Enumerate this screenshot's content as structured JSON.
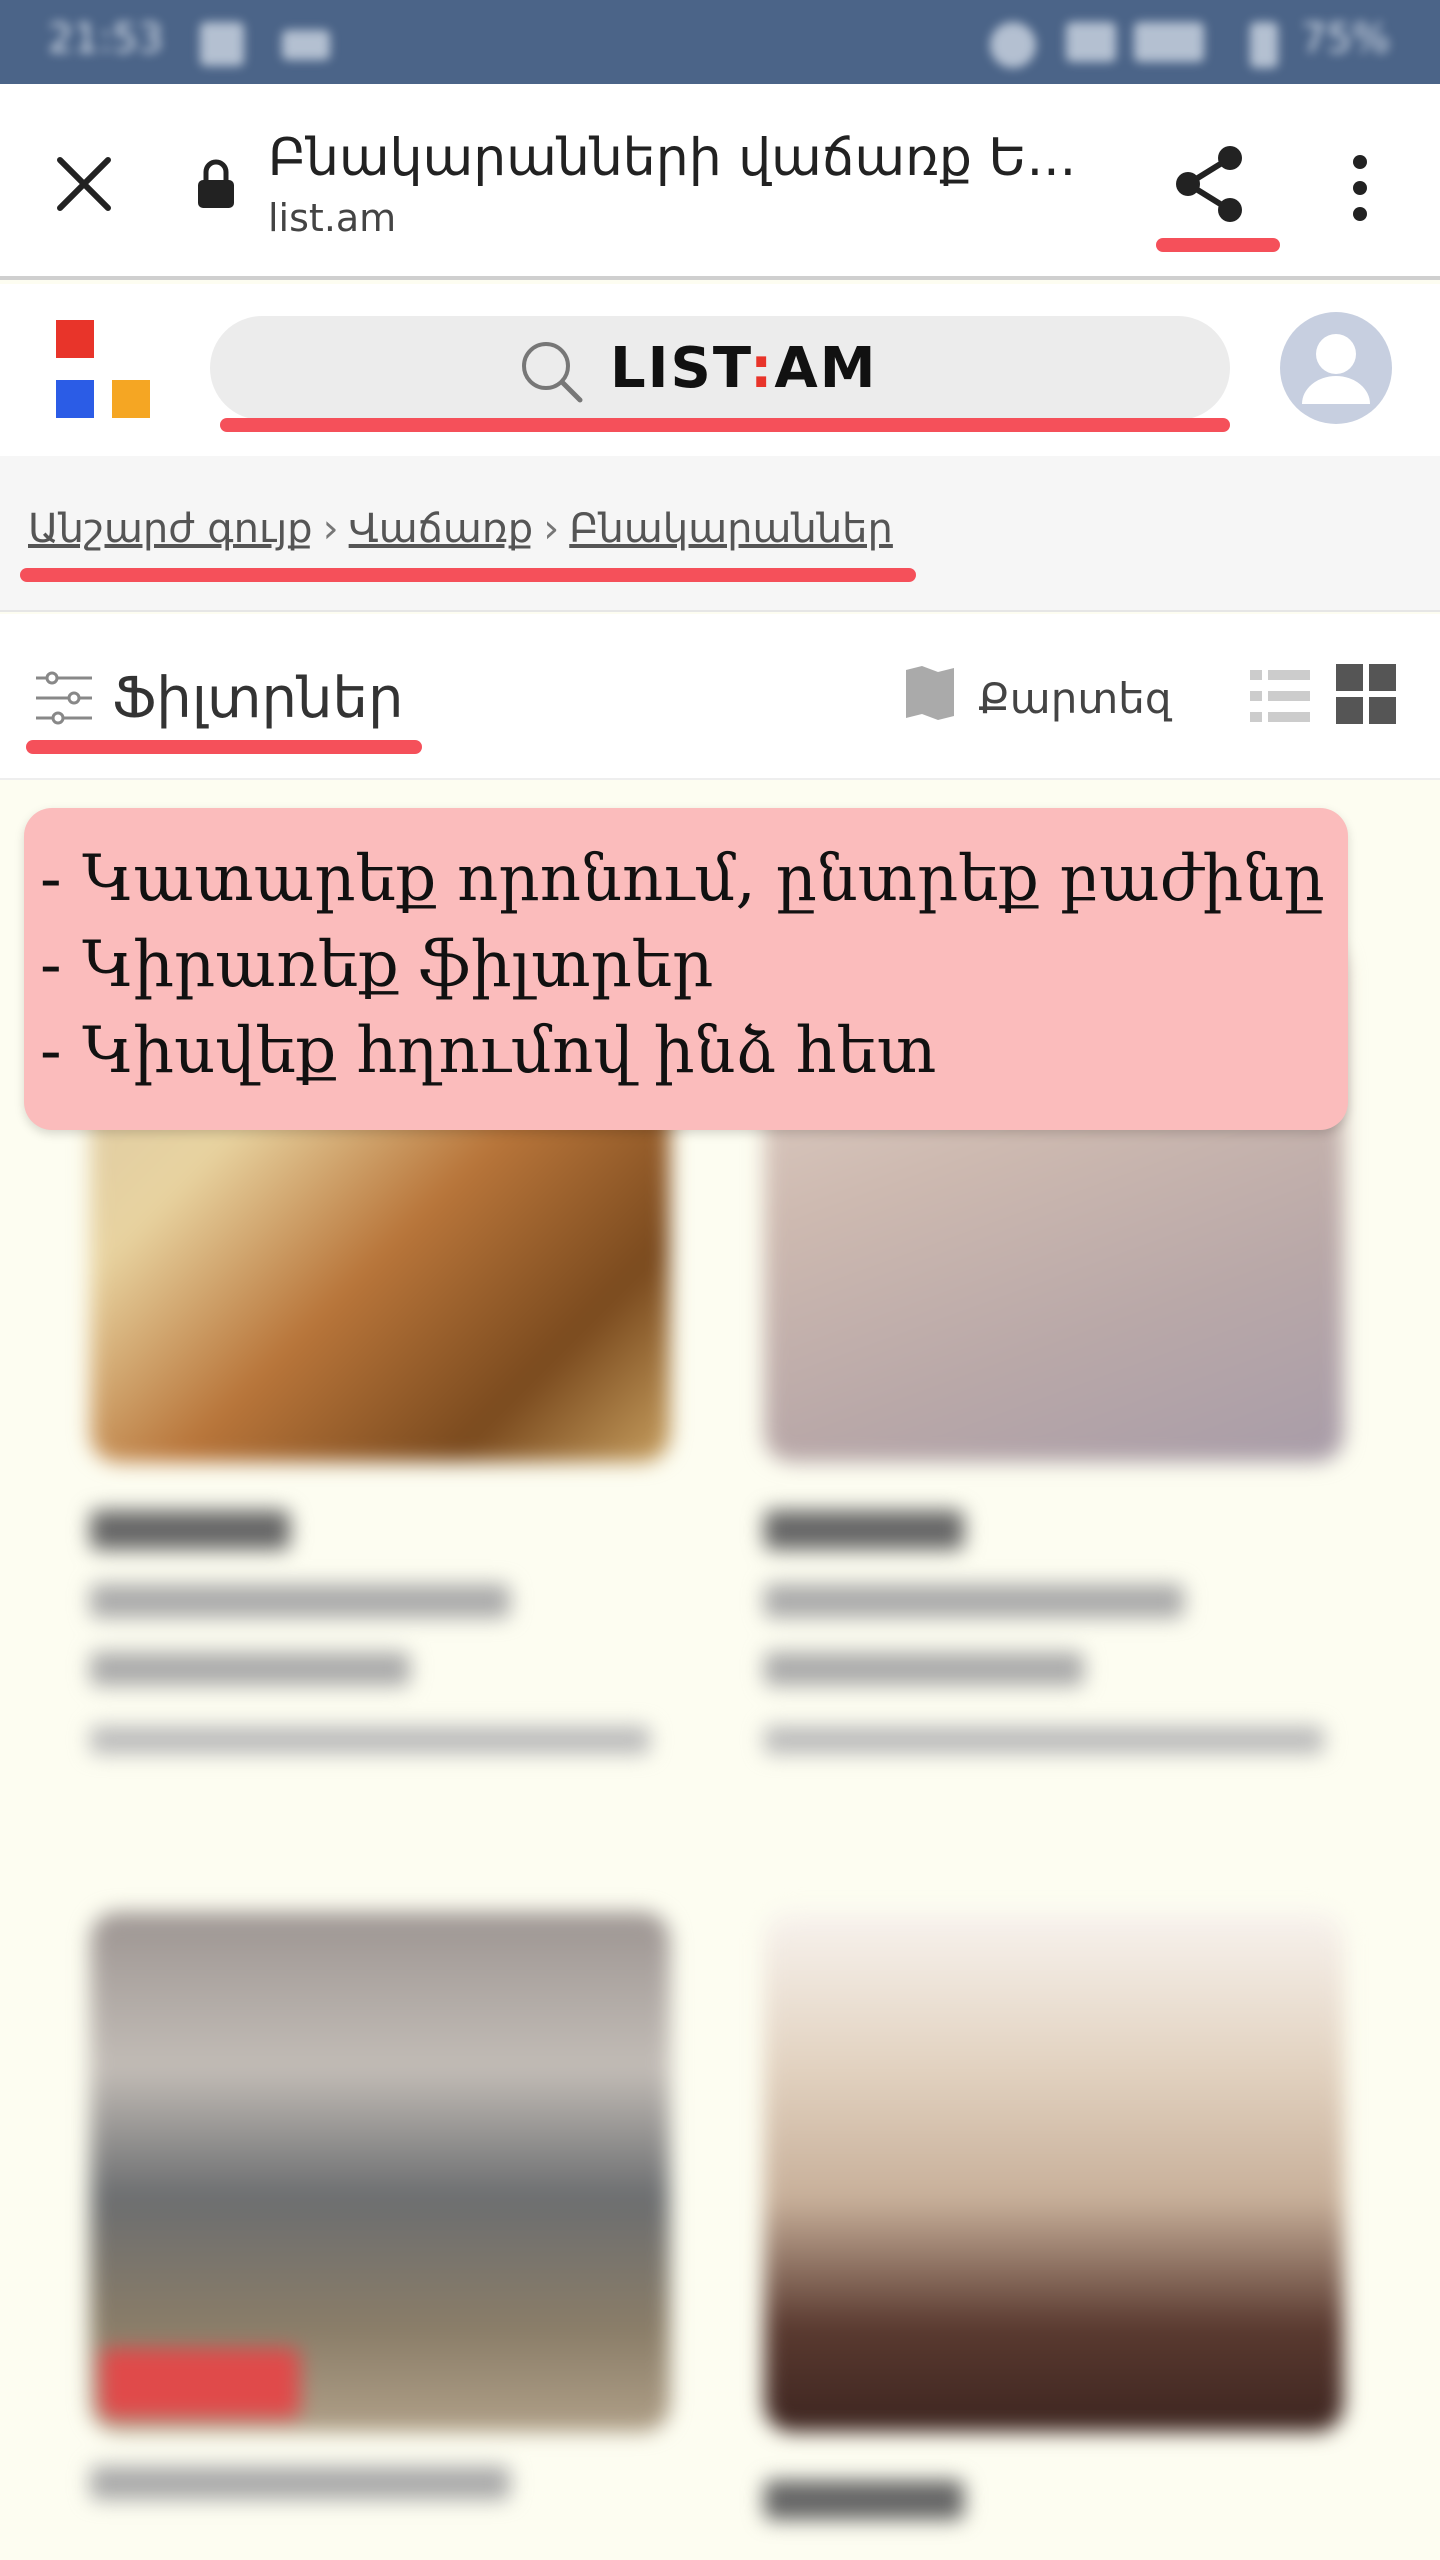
{
  "status_bar": {
    "time": "21:53",
    "battery": "75%"
  },
  "browser": {
    "title": "Բնակարանների վաճառք Ե...",
    "url": "list.am"
  },
  "site": {
    "logo_text": "LIST",
    "logo_dot": ":",
    "logo_suffix": "AM",
    "colors": {
      "red": "#e8342a",
      "blue": "#2b5ce6",
      "orange": "#f5a623"
    }
  },
  "breadcrumb": {
    "items": [
      "Անշարժ գույք",
      "Վաճառք",
      "Բնակարաններ"
    ],
    "separator": "›"
  },
  "toolbar": {
    "filters_label": "Ֆիլտրներ",
    "map_label": "Քարտեզ"
  },
  "note": {
    "lines": [
      "- Կատարեք որոնում, ընտրեք բաժինը",
      "- Կիրառեք ֆիլտրեր",
      "- Կիսվեք հղումով ինձ հետ"
    ]
  },
  "highlight_color": "#f5505a"
}
